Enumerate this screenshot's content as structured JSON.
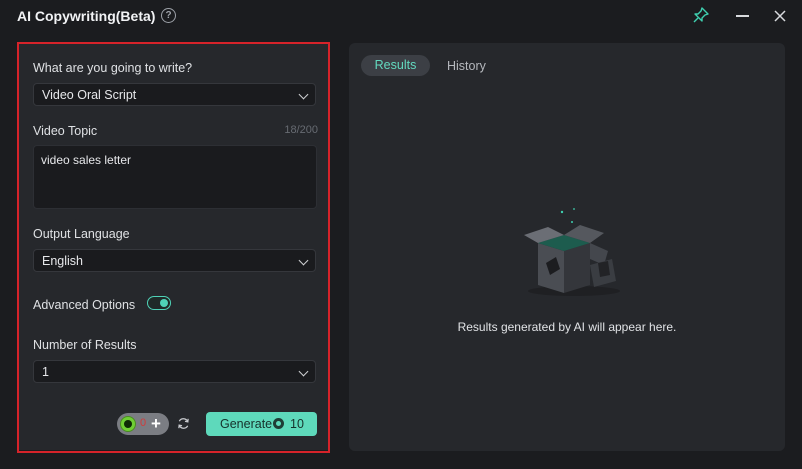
{
  "window": {
    "title": "AI Copywriting(Beta)"
  },
  "form": {
    "write_label": "What are you going to write?",
    "write_value": "Video Oral Script",
    "topic_label": "Video Topic",
    "topic_counter": "18/200",
    "topic_value": "video sales letter",
    "language_label": "Output Language",
    "language_value": "English",
    "advanced_label": "Advanced Options",
    "advanced_enabled": true,
    "results_label": "Number of Results",
    "results_value": "1"
  },
  "footer": {
    "credits": "0",
    "generate_label": "Generate",
    "generate_cost": "10"
  },
  "results_panel": {
    "tabs": [
      "Results",
      "History"
    ],
    "active_tab": "Results",
    "empty_message": "Results generated by AI will appear here."
  },
  "colors": {
    "accent": "#5ed9bb",
    "highlight_frame": "#d6232a",
    "background": "#1b1c1f"
  }
}
